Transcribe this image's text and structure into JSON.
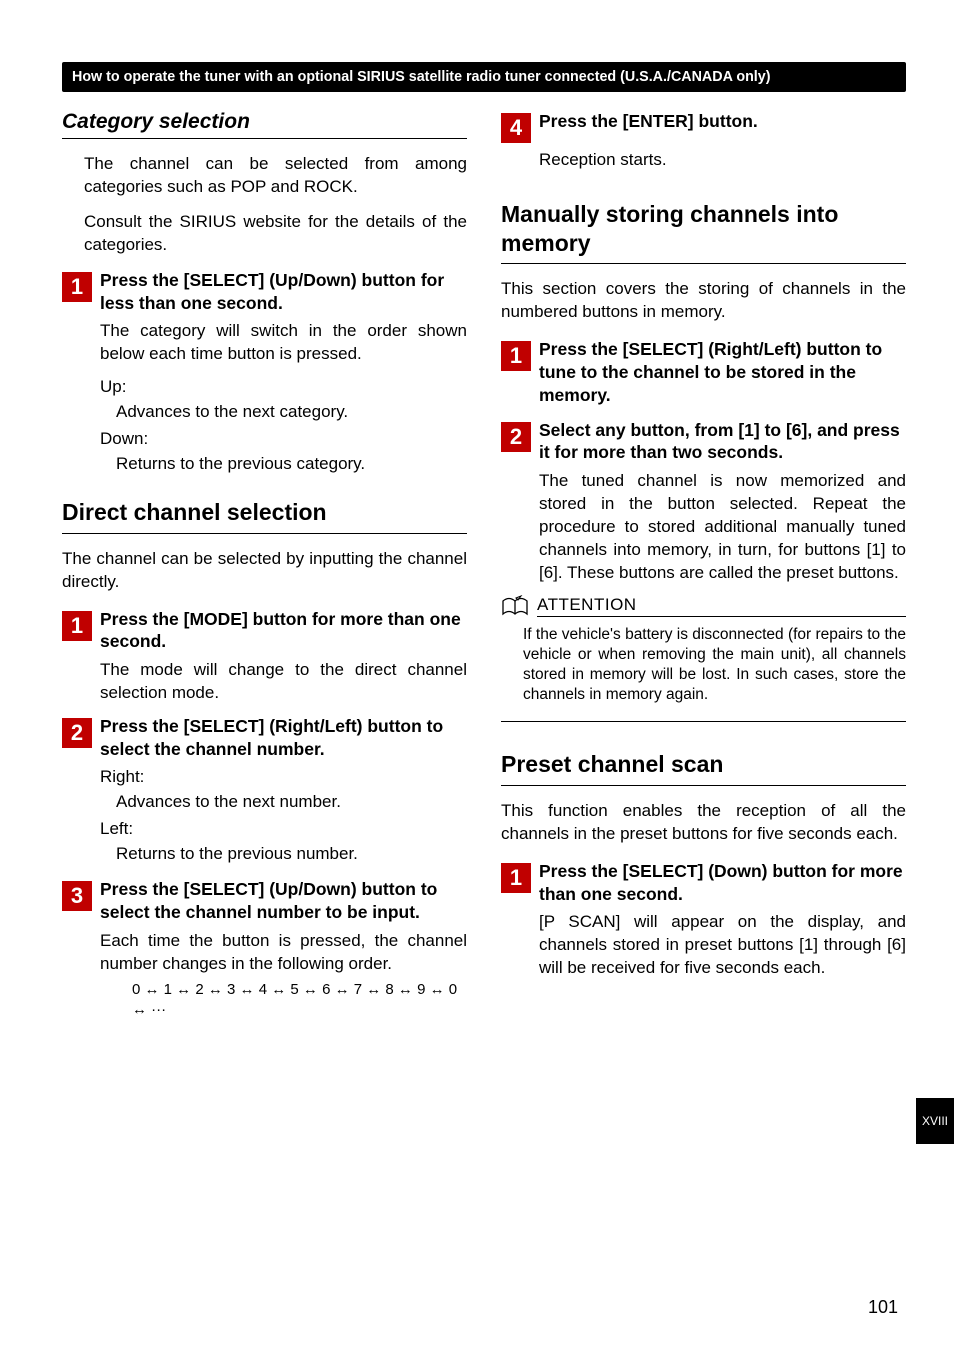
{
  "header": "How to operate the tuner with an optional SIRIUS satellite radio tuner connected (U.S.A./CANADA only)",
  "left": {
    "sec1": {
      "title": "Category selection",
      "p1": "The channel can be selected from among categories such as POP and ROCK.",
      "p2": "Consult the SIRIUS website for the details of the categories.",
      "step1": {
        "num": "1",
        "title": "Press the [SELECT] (Up/Down) button for less than one second.",
        "body": "The category will switch in the order shown below each time button is pressed.",
        "upLabel": "Up:",
        "upText": "Advances to the next category.",
        "downLabel": "Down:",
        "downText": "Returns to the previous category."
      }
    },
    "sec2": {
      "title": "Direct channel selection",
      "intro": "The channel can be selected by inputting the channel directly.",
      "step1": {
        "num": "1",
        "title": "Press the [MODE] button for more than one second.",
        "body": "The mode will change to the direct channel selection mode."
      },
      "step2": {
        "num": "2",
        "title": "Press the [SELECT] (Right/Left) button to select the channel number.",
        "rightLabel": "Right:",
        "rightText": "Advances to the next number.",
        "leftLabel": "Left:",
        "leftText": "Returns to the previous number."
      },
      "step3": {
        "num": "3",
        "title": "Press the [SELECT] (Up/Down) button to select the channel number to be input.",
        "body": "Each time the button is pressed, the channel number changes in the following order.",
        "seq": "0 ↔ 1 ↔ 2 ↔ 3 ↔ 4 ↔ 5 ↔ 6 ↔ 7 ↔ 8 ↔ 9 ↔ 0 ↔ ···"
      }
    }
  },
  "right": {
    "step4": {
      "num": "4",
      "title": "Press the [ENTER] button.",
      "body": "Reception starts."
    },
    "sec3": {
      "title": "Manually storing channels into memory",
      "intro": "This section covers the storing of channels in the numbered buttons in memory.",
      "step1": {
        "num": "1",
        "title": "Press the [SELECT] (Right/Left) button to tune to the channel to be stored in the memory."
      },
      "step2": {
        "num": "2",
        "title": "Select any button, from [1] to [6], and press it for more than two seconds.",
        "body": "The tuned channel is now memorized and stored in the button selected. Repeat the procedure to stored additional manually tuned channels into memory, in turn, for buttons [1] to [6]. These buttons are called the preset buttons."
      },
      "attentionLabel": "ATTENTION",
      "attentionBody": "If the vehicle's battery is disconnected (for repairs to the vehicle or when removing the main unit), all channels stored in memory will be lost. In such cases, store the channels in memory again."
    },
    "sec4": {
      "title": "Preset channel scan",
      "intro": "This function enables the reception of all the channels in the preset buttons for five seconds each.",
      "step1": {
        "num": "1",
        "title": "Press the [SELECT] (Down) button for more than one second.",
        "body": "[P SCAN] will appear on the display, and channels stored in preset buttons [1] through [6] will be received for five seconds each."
      }
    }
  },
  "sideTab": "XVIII",
  "pageNumber": "101"
}
